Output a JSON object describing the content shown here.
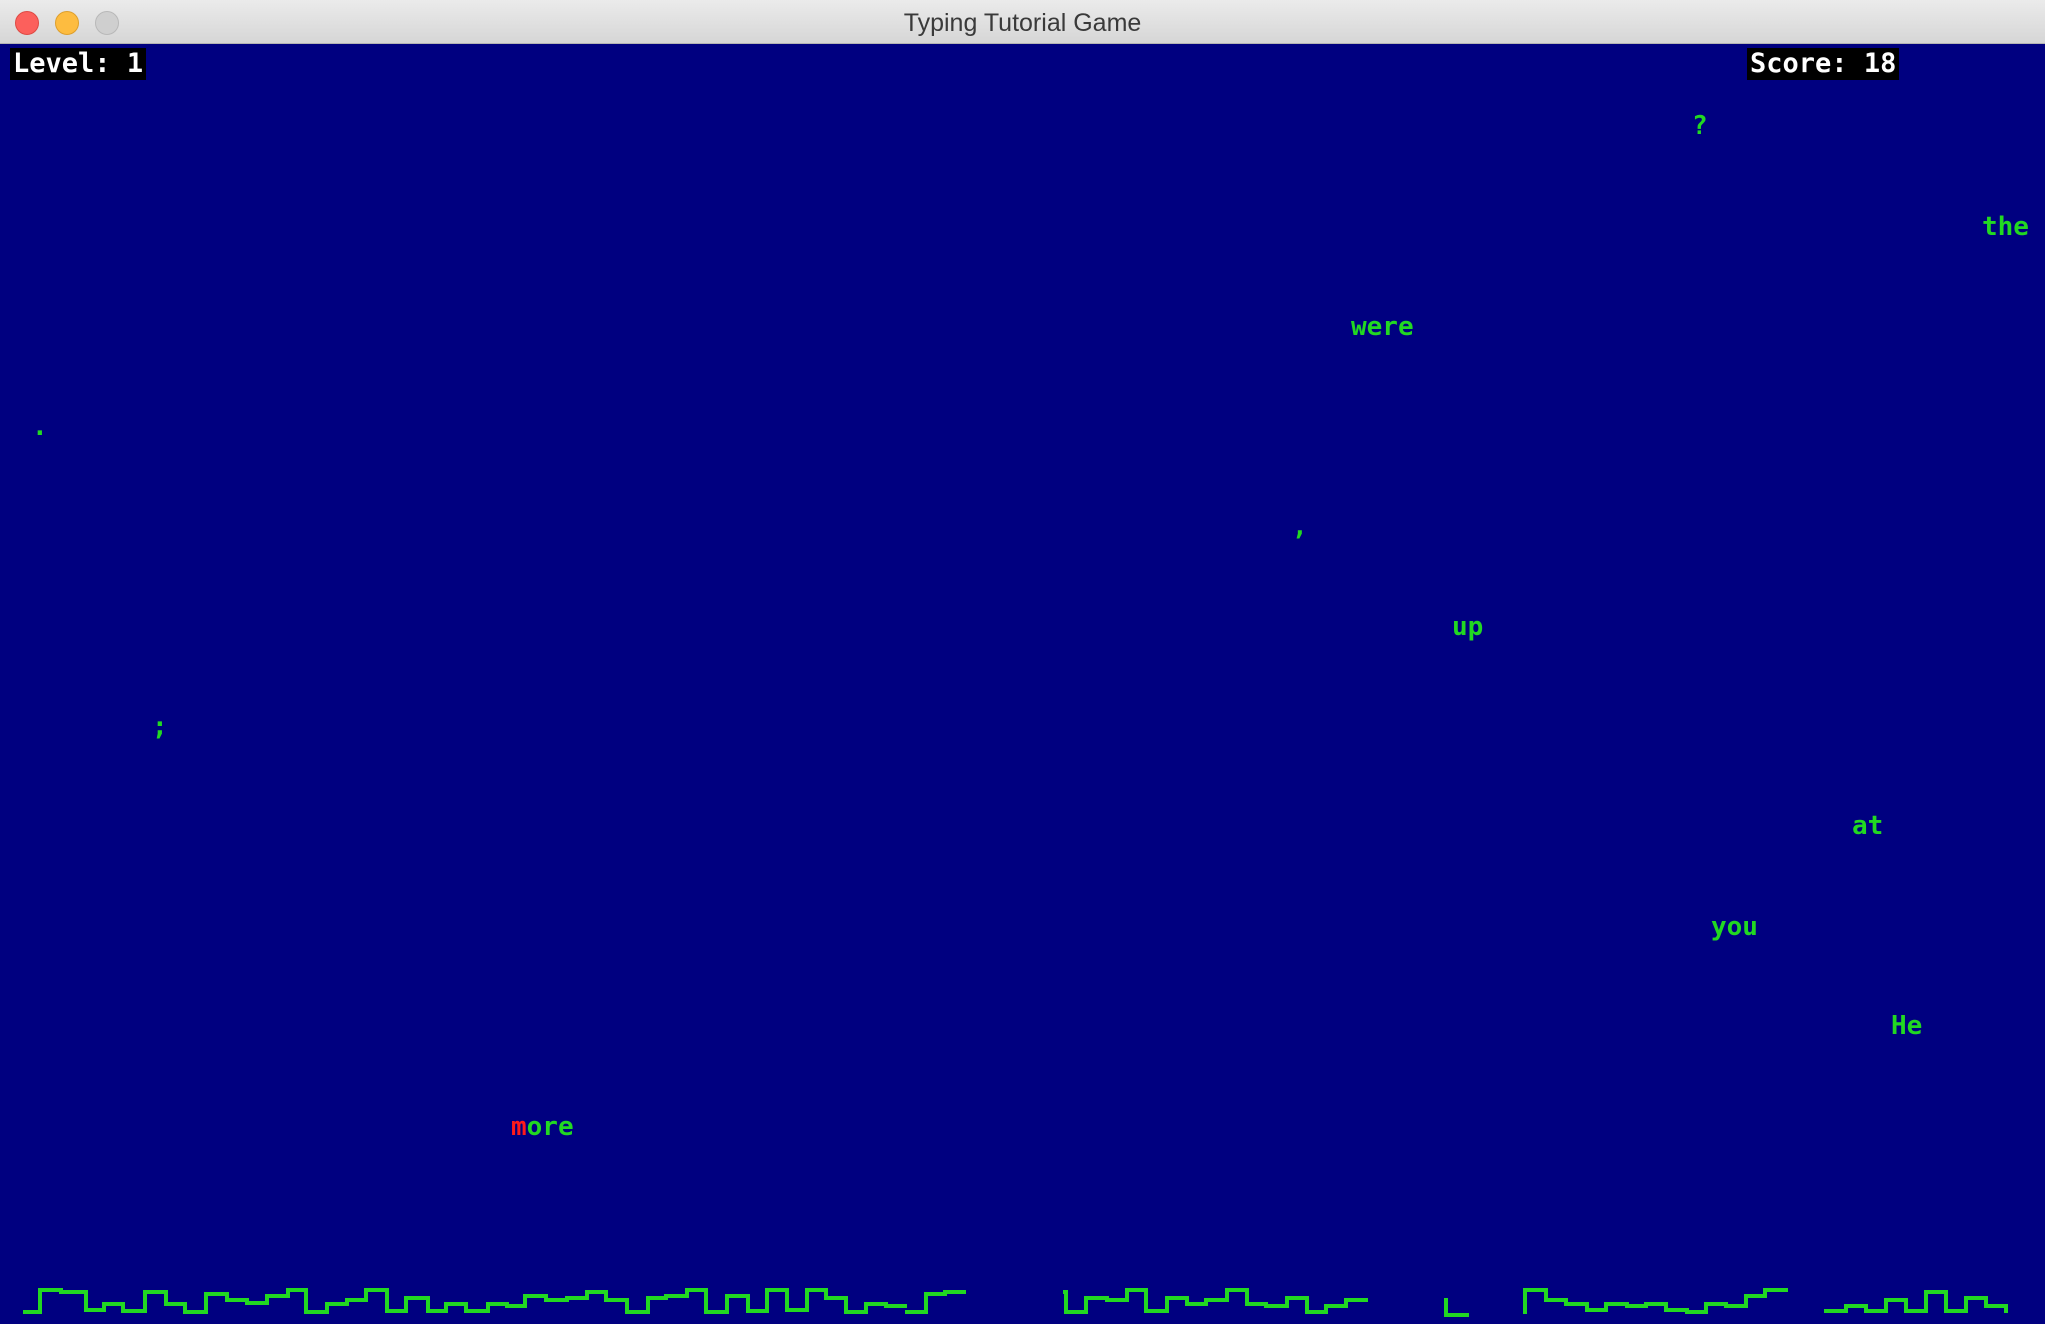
{
  "window": {
    "title": "Typing Tutorial Game"
  },
  "hud": {
    "level_label": "Level:",
    "level": "1",
    "score_label": "Score:",
    "score": "18"
  },
  "words": [
    {
      "text": "?"
    },
    {
      "text": "the"
    },
    {
      "text": "were"
    },
    {
      "text": "."
    },
    {
      "text": ","
    },
    {
      "text": "up"
    },
    {
      "text": ";"
    },
    {
      "text": "at"
    },
    {
      "text": "you"
    },
    {
      "text": "He"
    },
    {
      "typed": "m",
      "remaining": "ore"
    }
  ],
  "colors": {
    "sky": "#000080",
    "word": "#22d822",
    "typed": "#ff1a1a",
    "city_outline": "#22d822",
    "hud_background": "#000000",
    "hud_text": "#ffffff"
  }
}
